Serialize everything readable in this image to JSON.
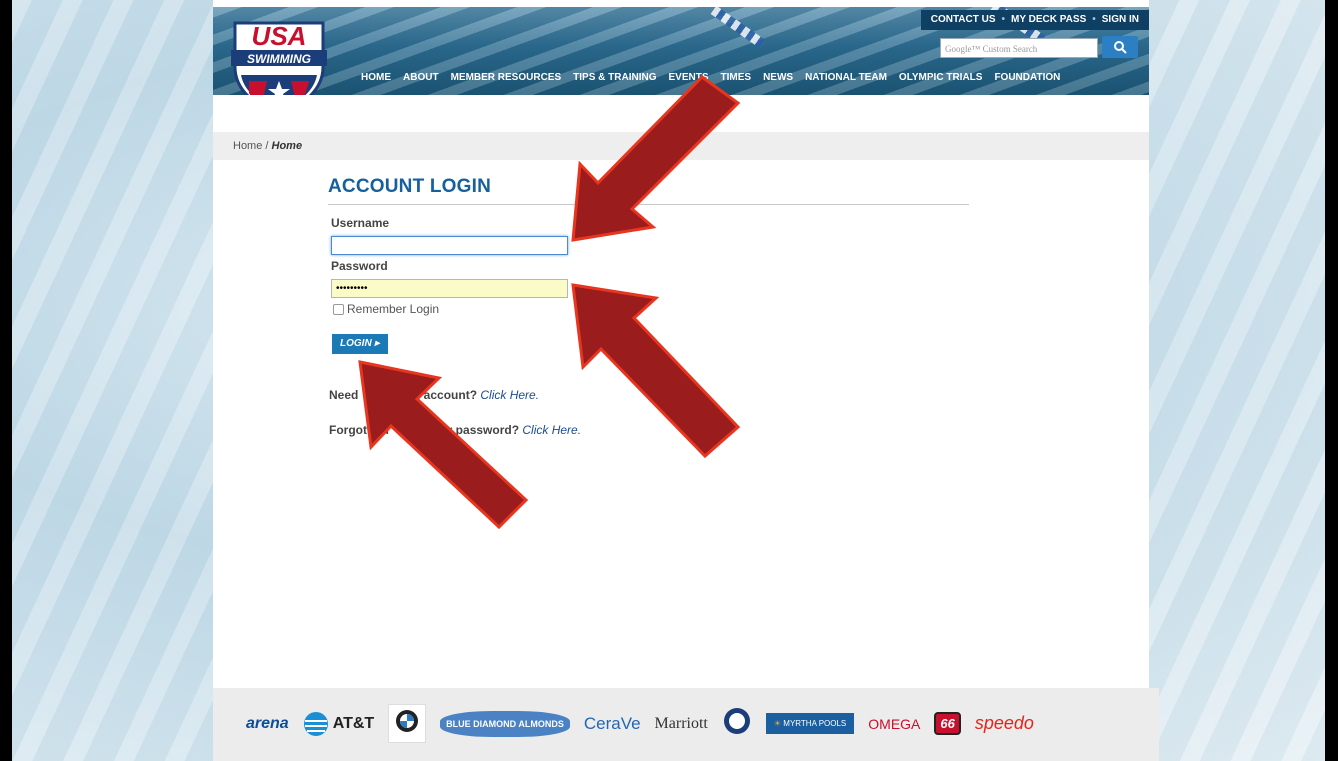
{
  "header": {
    "logo_text_1": "USA",
    "logo_text_2": "SWIMMING",
    "util_links": [
      "CONTACT US",
      "MY DECK PASS",
      "SIGN IN"
    ],
    "search_placeholder": "Google™ Custom Search",
    "nav": [
      "HOME",
      "ABOUT",
      "MEMBER RESOURCES",
      "TIPS & TRAINING",
      "EVENTS",
      "TIMES",
      "NEWS",
      "NATIONAL TEAM",
      "OLYMPIC TRIALS",
      "FOUNDATION"
    ]
  },
  "breadcrumb": {
    "home": "Home",
    "sep": " / ",
    "current": "Home"
  },
  "login": {
    "title": "ACCOUNT LOGIN",
    "username_label": "Username",
    "username_value": "",
    "password_label": "Password",
    "password_value": "•••••••••",
    "remember_label": "Remember Login",
    "login_button": "LOGIN ▸",
    "need_account_text": "Need",
    "need_account_tail": "an account?",
    "need_account_link": "Click Here.",
    "forgot_text": "Forgot",
    "forgot_mid": "our",
    "forgot_tail": "e or password?",
    "forgot_link": "Click Here."
  },
  "sponsors": [
    "arena",
    "AT&T",
    "BMW",
    "BLUE DIAMOND ALMONDS",
    "CeraVe",
    "Marriott",
    "Mutual of Omaha",
    "MYRTHA POOLS",
    "OMEGA",
    "66",
    "speedo"
  ],
  "colors": {
    "arrow": "#9b1c1c",
    "arrow_outline": "#e8351f",
    "link": "#1a4c93",
    "title": "#16609e",
    "button": "#1b79b6"
  }
}
